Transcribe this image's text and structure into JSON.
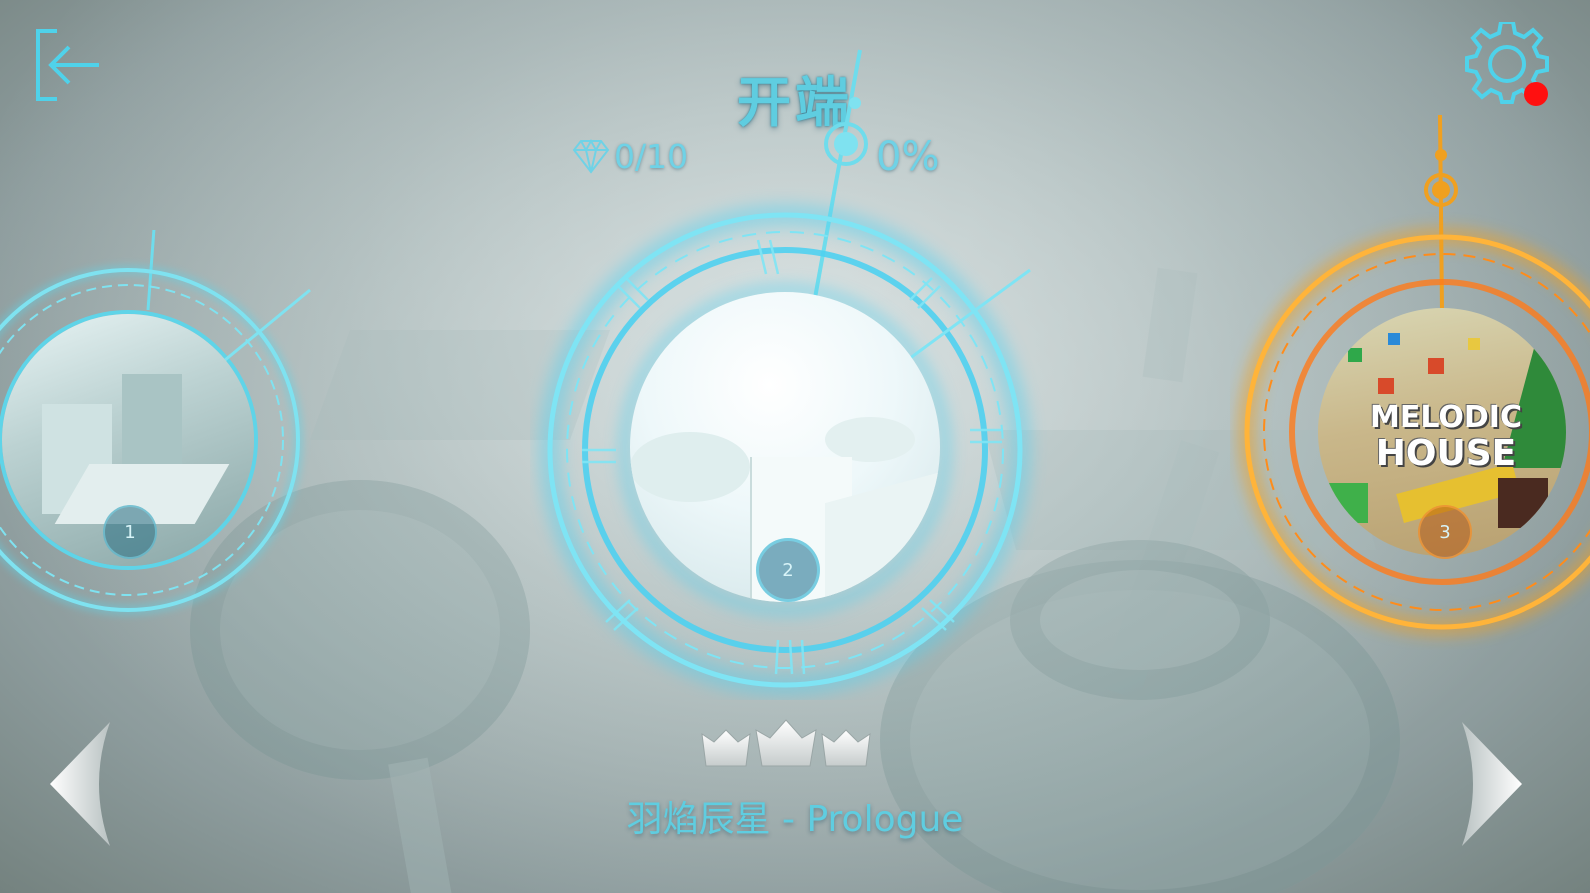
{
  "header": {
    "title": "开端",
    "back_icon": "exit-arrow-icon",
    "settings_icon": "gear-icon",
    "notification_color": "#ff1010"
  },
  "stats": {
    "gems": "0/10",
    "gem_icon": "diamond-icon",
    "progress": "0%"
  },
  "levels": [
    {
      "number": "1",
      "theme_color": "#5fd4e8"
    },
    {
      "number": "2",
      "theme_color": "#4fd0f0",
      "selected": true
    },
    {
      "number": "3",
      "theme_color": "#f0a020",
      "logo_line1": "MELODIC",
      "logo_line2": "HOUSE"
    }
  ],
  "rating": {
    "crowns_total": 3,
    "crowns_earned": 0
  },
  "song": {
    "name": "羽焰辰星 - Prologue"
  },
  "nav": {
    "prev_icon": "chevron-left-icon",
    "next_icon": "chevron-right-icon"
  }
}
